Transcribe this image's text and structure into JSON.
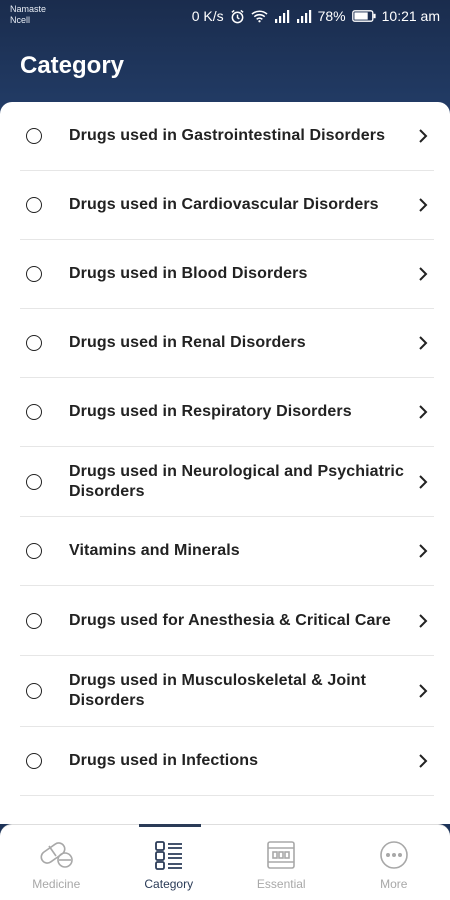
{
  "status_bar": {
    "carrier_line1": "Namaste",
    "carrier_line2": "Ncell",
    "speed": "0 K/s",
    "battery": "78%",
    "time": "10:21 am"
  },
  "header": {
    "title": "Category"
  },
  "categories": [
    "Drugs used in Gastrointestinal Disorders",
    "Drugs used in Cardiovascular Disorders",
    "Drugs used in Blood Disorders",
    "Drugs used in Renal Disorders",
    "Drugs used in Respiratory Disorders",
    "Drugs used in Neurological and Psychiatric Disorders",
    "Vitamins and Minerals",
    "Drugs used for Anesthesia & Critical Care",
    "Drugs used in Musculoskeletal & Joint Disorders",
    "Drugs used in Infections"
  ],
  "tabbar": {
    "tabs": [
      {
        "label": "Medicine",
        "icon": "pill-icon",
        "active": false
      },
      {
        "label": "Category",
        "icon": "category-list-icon",
        "active": true
      },
      {
        "label": "Essential",
        "icon": "essential-grid-icon",
        "active": false
      },
      {
        "label": "More",
        "icon": "more-dots-icon",
        "active": false
      }
    ]
  },
  "colors": {
    "header_bg": "#1d3358",
    "active_tab": "#2a3b57",
    "inactive_tab": "#a8a8a8"
  }
}
